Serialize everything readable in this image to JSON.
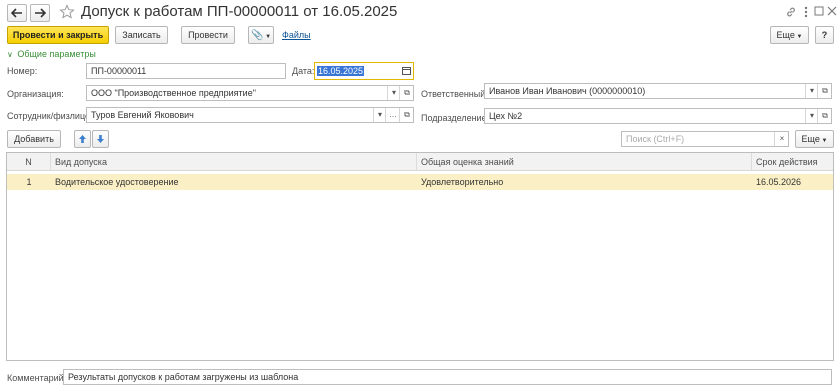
{
  "title": "Допуск к работам ПП-00000011 от 16.05.2025",
  "toolbar": {
    "post_close": "Провести и закрыть",
    "save": "Записать",
    "post": "Провести",
    "files": "Файлы",
    "more": "Еще"
  },
  "group": {
    "label": "Общие параметры"
  },
  "fields": {
    "number_label": "Номер:",
    "number_value": "ПП-00000011",
    "date_label": "Дата:",
    "date_value": "16.05.2025",
    "org_label": "Организация:",
    "org_value": "ООО \"Производственное предприятие\"",
    "resp_label": "Ответственный:",
    "resp_value": "Иванов Иван Иванович (0000000010)",
    "emp_label": "Сотрудник/физлицо:",
    "emp_value": "Туров Евгений Яковович",
    "dept_label": "Подразделение:",
    "dept_value": "Цех №2"
  },
  "table_toolbar": {
    "add": "Добавить",
    "search_placeholder": "Поиск (Ctrl+F)",
    "more": "Еще"
  },
  "table": {
    "columns": [
      "N",
      "Вид допуска",
      "Общая оценка знаний",
      "Срок действия"
    ],
    "rows": [
      {
        "n": "1",
        "type": "Водительское удостоверение",
        "score": "Удовлетворительно",
        "expiry": "16.05.2026"
      }
    ]
  },
  "comment": {
    "label": "Комментарий:",
    "value": "Результаты допусков к работам загружены из шаблона"
  },
  "colors": {
    "accent": "#f5cf00",
    "selected_row": "#fbf0c5",
    "link": "#0b5394",
    "group": "#3a8f3a"
  }
}
